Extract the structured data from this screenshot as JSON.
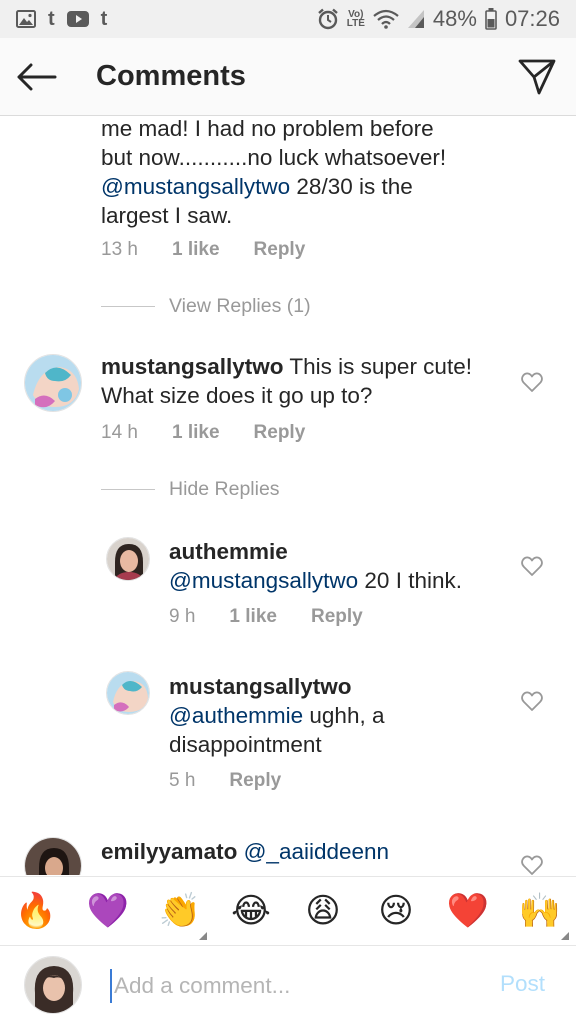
{
  "status_bar": {
    "left_icons": [
      "image-icon",
      "tumblr-icon",
      "youtube-icon",
      "tumblr-icon"
    ],
    "volte_line1": "Vo)",
    "volte_line2": "LTE",
    "battery_percent": "48%",
    "time": "07:26"
  },
  "header": {
    "title": "Comments"
  },
  "comments": {
    "c0": {
      "line1": "me mad! I had no problem before",
      "line2": "but now...........no luck whatsoever!",
      "mention": "@mustangsallytwo",
      "line3_rest": " 28/30 is the",
      "line4": "largest I saw.",
      "time": "13 h",
      "likes": "1 like",
      "reply": "Reply"
    },
    "view_replies": "View Replies (1)",
    "c1": {
      "username": "mustangsallytwo",
      "text_a": " This is super cute!",
      "text_b": "What size does it go up to?",
      "time": "14 h",
      "likes": "1 like",
      "reply": "Reply"
    },
    "hide_replies": "Hide Replies",
    "r1": {
      "username": "authemmie",
      "mention": "@mustangsallytwo",
      "text": " 20 I think.",
      "time": "9 h",
      "likes": "1 like",
      "reply": "Reply"
    },
    "r2": {
      "username": "mustangsallytwo",
      "mention": "@authemmie",
      "text_a": " ughh, a",
      "text_b": "disappointment",
      "time": "5 h",
      "reply": "Reply"
    },
    "c2": {
      "username": "emilyyamato",
      "mention": "@_aaiiddeenn"
    }
  },
  "emoji_bar": {
    "emojis": [
      "🔥",
      "💜",
      "👏",
      "😂",
      "😩",
      "😢",
      "❤️",
      "🙌"
    ]
  },
  "composer": {
    "placeholder": "Add a comment...",
    "post_label": "Post"
  },
  "colors": {
    "mention": "#003569",
    "meta_gray": "#999999",
    "post_disabled": "#b2dffc"
  }
}
